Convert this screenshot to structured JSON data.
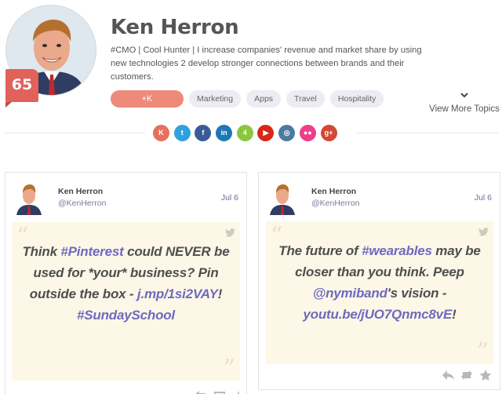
{
  "profile": {
    "name": "Ken Herron",
    "score": "65",
    "bio": "#CMO | Cool Hunter | I increase companies' revenue and market share by using new technologies 2 develop stronger connections between brands and their customers.",
    "plusk_label": "+K",
    "topics": [
      "Marketing",
      "Apps",
      "Travel",
      "Hospitality"
    ],
    "view_more_label": "View More Topics"
  },
  "socials": [
    {
      "name": "klout",
      "color": "#e6705d",
      "glyph": "K"
    },
    {
      "name": "twitter",
      "color": "#2fa2dd",
      "glyph": "t"
    },
    {
      "name": "facebook",
      "color": "#3b5b98",
      "glyph": "f"
    },
    {
      "name": "linkedin",
      "color": "#1d78b3",
      "glyph": "in"
    },
    {
      "name": "foursquare",
      "color": "#8ac73d",
      "glyph": "4"
    },
    {
      "name": "youtube",
      "color": "#d9261b",
      "glyph": "▶"
    },
    {
      "name": "instagram",
      "color": "#4c7aa1",
      "glyph": "◎"
    },
    {
      "name": "flickr",
      "color": "#ef3e8b",
      "glyph": "●●"
    },
    {
      "name": "googleplus",
      "color": "#d34836",
      "glyph": "g+"
    }
  ],
  "tweets": [
    {
      "author": "Ken Herron",
      "handle": "@KenHerron",
      "date": "Jul 6",
      "parts": [
        {
          "t": "Think ",
          "h": false
        },
        {
          "t": "#Pinterest",
          "h": true
        },
        {
          "t": " could NEVER be used for *your* business? Pin outside the box - ",
          "h": false
        },
        {
          "t": "j.mp/1si2VAY",
          "h": true
        },
        {
          "t": "! ",
          "h": false
        },
        {
          "t": "#SundaySchool",
          "h": true
        }
      ]
    },
    {
      "author": "Ken Herron",
      "handle": "@KenHerron",
      "date": "Jul 6",
      "parts": [
        {
          "t": "The future of ",
          "h": false
        },
        {
          "t": "#wearables",
          "h": true
        },
        {
          "t": " may be closer than you think. Peep ",
          "h": false
        },
        {
          "t": "@nymiband",
          "h": true
        },
        {
          "t": "'s vision - ",
          "h": false
        },
        {
          "t": "youtu.be/jUO7Qnmc8vE",
          "h": true
        },
        {
          "t": "!",
          "h": false
        }
      ]
    }
  ]
}
